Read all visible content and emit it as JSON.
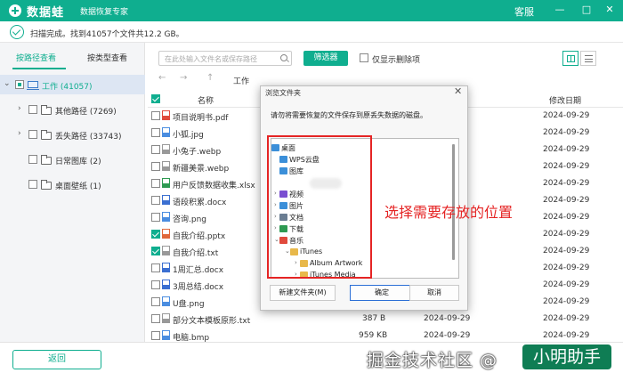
{
  "titlebar": {
    "app_name": "数据蛙",
    "subtitle": "数据恢复专家",
    "service": "客服",
    "minimize": "—",
    "maximize": "□",
    "close": "✕"
  },
  "status": {
    "text": "扫描完成。找到41057个文件共12.2 GB。"
  },
  "left": {
    "tabs": [
      {
        "label": "按路径查看"
      },
      {
        "label": "按类型查看"
      }
    ],
    "root": {
      "label": "工作 (41057)"
    },
    "items": [
      {
        "label": "其他路径 (7269)"
      },
      {
        "label": "丢失路径 (33743)"
      },
      {
        "label": "日常图库 (2)"
      },
      {
        "label": "桌面壁纸 (1)"
      }
    ]
  },
  "toolbar": {
    "search_placeholder": "在此处输入文件名或保存路径",
    "filter": "筛选器",
    "only_deleted": "仅显示删除项"
  },
  "nav": {
    "back": "←",
    "forward": "→",
    "up": "↑",
    "crumb": "工作"
  },
  "table": {
    "headers": {
      "name": "名称",
      "mtime": "修改日期"
    },
    "rows": [
      {
        "name": "项目说明书.pdf",
        "size": "",
        "ctime": "",
        "mtime": "2024-09-29",
        "checked": false,
        "color": "#e04a3c"
      },
      {
        "name": "小狐.jpg",
        "size": "",
        "ctime": "",
        "mtime": "2024-09-29",
        "checked": false,
        "color": "#4a8de0"
      },
      {
        "name": "小兔子.webp",
        "size": "",
        "ctime": "",
        "mtime": "2024-09-29",
        "checked": false,
        "color": "#999999"
      },
      {
        "name": "新疆美景.webp",
        "size": "",
        "ctime": "",
        "mtime": "2024-09-29",
        "checked": false,
        "color": "#999999"
      },
      {
        "name": "用户反馈数据收集.xlsx",
        "size": "",
        "ctime": "",
        "mtime": "2024-09-29",
        "checked": false,
        "color": "#2e9a52"
      },
      {
        "name": "语段积累.docx",
        "size": "",
        "ctime": "",
        "mtime": "2024-09-29",
        "checked": false,
        "color": "#3b6fd1"
      },
      {
        "name": "咨询.png",
        "size": "",
        "ctime": "",
        "mtime": "2024-09-29",
        "checked": false,
        "color": "#4a8de0"
      },
      {
        "name": "自我介绍.pptx",
        "size": "",
        "ctime": "",
        "mtime": "2024-09-29",
        "checked": true,
        "color": "#e0693c"
      },
      {
        "name": "自我介绍.txt",
        "size": "",
        "ctime": "",
        "mtime": "2024-09-29",
        "checked": true,
        "color": "#999999"
      },
      {
        "name": "1周汇总.docx",
        "size": "",
        "ctime": "",
        "mtime": "2024-09-29",
        "checked": false,
        "color": "#3b6fd1"
      },
      {
        "name": "3周总结.docx",
        "size": "",
        "ctime": "",
        "mtime": "2024-09-29",
        "checked": false,
        "color": "#3b6fd1"
      },
      {
        "name": "U盘.png",
        "size": "",
        "ctime": "",
        "mtime": "2024-09-29",
        "checked": false,
        "color": "#4a8de0"
      },
      {
        "name": "部分文本模板原形.txt",
        "size": "387 B",
        "ctime": "2024-09-29",
        "mtime": "2024-09-29",
        "checked": false,
        "color": "#999999"
      },
      {
        "name": "电脑.bmp",
        "size": "959 KB",
        "ctime": "2024-09-29",
        "mtime": "2024-09-29",
        "checked": false,
        "color": "#4a8de0"
      }
    ]
  },
  "dialog": {
    "title": "浏览文件夹",
    "close": "✕",
    "prompt": "请勿将需要恢复的文件保存到原丢失数据的磁盘。",
    "tree": [
      {
        "label": "桌面",
        "color": "#3b8fd9",
        "chev": ""
      },
      {
        "label": "WPS云盘",
        "color": "#3b8fd9",
        "chev": ""
      },
      {
        "label": "图库",
        "color": "#3b8fd9",
        "chev": ""
      },
      {
        "label": "视频",
        "color": "#7a4fd1",
        "chev": "›"
      },
      {
        "label": "图片",
        "color": "#3b8fd9",
        "chev": "›"
      },
      {
        "label": "文档",
        "color": "#6a7d92",
        "chev": "›"
      },
      {
        "label": "下载",
        "color": "#2e9a52",
        "chev": "›"
      },
      {
        "label": "音乐",
        "color": "#e04a3c",
        "chev": "⌄"
      },
      {
        "label": "iTunes",
        "color": "#e8b84a",
        "chev": "⌄"
      },
      {
        "label": "Album Artwork",
        "color": "#e8b84a",
        "chev": "›"
      },
      {
        "label": "iTunes Media",
        "color": "#e8b84a",
        "chev": "›"
      }
    ],
    "new_folder": "新建文件夹(M)",
    "ok": "确定",
    "cancel": "取消"
  },
  "annotation": "选择需要存放的位置",
  "bottom": {
    "back": "返回",
    "watermark": "掘金技术社区 @",
    "watermark_tail": "小明助手"
  }
}
